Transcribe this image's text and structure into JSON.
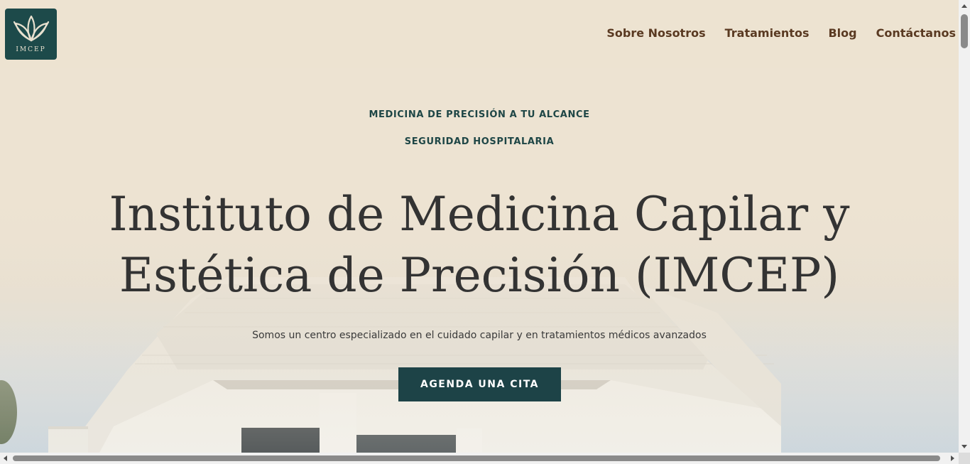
{
  "header": {
    "logo_text": "IMCEP",
    "nav": [
      {
        "label": "Sobre Nosotros"
      },
      {
        "label": "Tratamientos"
      },
      {
        "label": "Blog"
      },
      {
        "label": "Contáctanos"
      }
    ]
  },
  "hero": {
    "eyebrow_1": "MEDICINA DE PRECISIÓN A TU ALCANCE",
    "eyebrow_2": "SEGURIDAD HOSPITALARIA",
    "title_line_1": "Instituto de Medicina Capilar y",
    "title_line_2": "Estética de Precisión (IMCEP)",
    "subtitle": "Somos un centro especializado en el cuidado capilar y en tratamientos médicos avanzados",
    "cta_label": "AGENDA UNA CITA"
  },
  "colors": {
    "background": "#ede3d2",
    "brand": "#1d4a4a",
    "nav_text": "#5a3a22",
    "title": "#333333",
    "cta_bg": "#1d4347"
  },
  "icons": {
    "logo": "leaf-icon"
  }
}
